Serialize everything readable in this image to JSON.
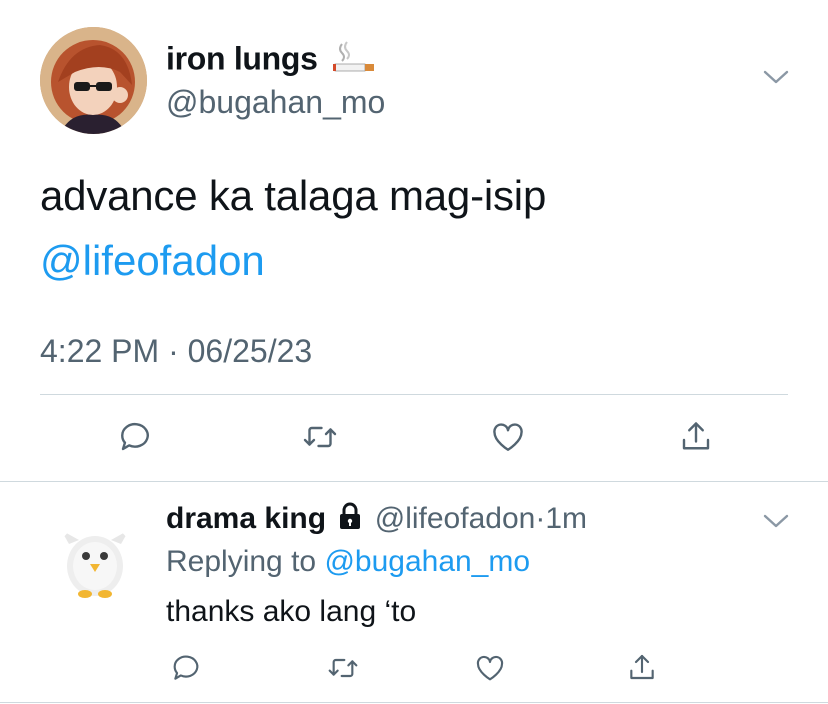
{
  "tweet": {
    "author_name": "iron lungs",
    "author_emoji": "cigarette-icon",
    "handle": "@bugahan_mo",
    "text": "advance ka talaga mag-isip",
    "mention": "@lifeofadon",
    "timestamp": "4:22 PM · 06/25/23"
  },
  "actions": [
    "reply-icon",
    "retweet-icon",
    "like-icon",
    "share-icon"
  ],
  "reply": {
    "author_name": "drama king",
    "lock_icon": "lock-icon",
    "handle": "@lifeofadon",
    "separator": "·",
    "time": "1m",
    "replying_prefix": "Replying to",
    "replying_to": "@bugahan_mo",
    "text": "thanks ako lang ‘to"
  },
  "colors": {
    "text": "#0f1419",
    "secondary": "#536471",
    "link": "#1d9bf0",
    "border": "#cfd9de",
    "icon": "#536471"
  }
}
